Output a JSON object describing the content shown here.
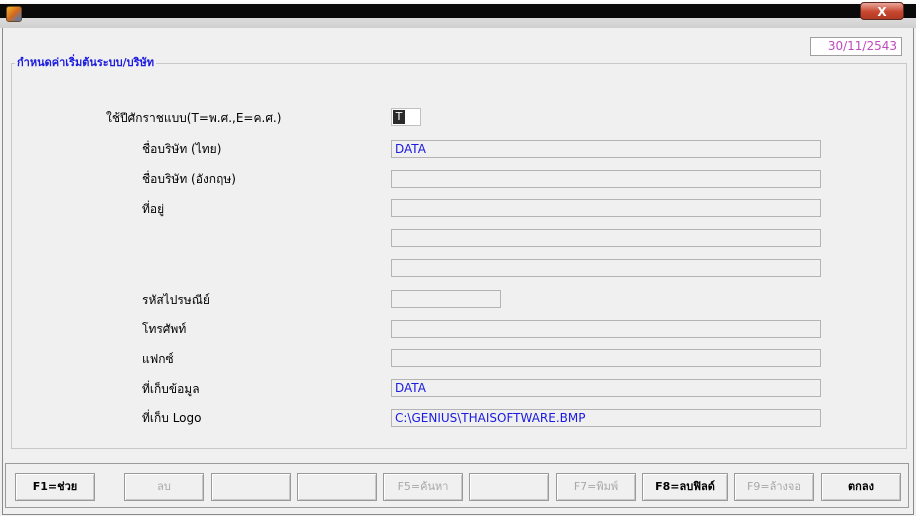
{
  "window": {
    "close_label": "X"
  },
  "date": "30/11/2543",
  "group_title": "กำหนดค่าเริ่มต้นระบบ/บริษัท",
  "form": {
    "era_label": "ใช้ปีศักราชแบบ(T=พ.ศ.,E=ค.ศ.)",
    "era_value": "T",
    "company_thai_label": "ชื่อบริษัท (ไทย)",
    "company_thai_value": "DATA",
    "company_eng_label": "ชื่อบริษัท (อังกฤษ)",
    "company_eng_value": "",
    "address_label": "ที่อยู่",
    "address_line1": "",
    "address_line2": "",
    "address_line3": "",
    "postcode_label": "รหัสไปรษณีย์",
    "postcode_value": "",
    "phone_label": "โทรศัพท์",
    "phone_value": "",
    "fax_label": "แฟกซ์",
    "fax_value": "",
    "data_dir_label": "ที่เก็บข้อมูล",
    "data_dir_value": "DATA",
    "logo_label": "ที่เก็บ Logo",
    "logo_value": "C:\\GENIUS\\THAISOFTWARE.BMP"
  },
  "buttons": {
    "f1": "F1=ช่วย",
    "delete": "ลบ",
    "blank1": "",
    "blank2": "",
    "f5": "F5=ค้นหา",
    "blank3": "",
    "f7": "F7=พิมพ์",
    "f8": "F8=ลบฟิลด์",
    "f9": "F9=ล้างจอ",
    "ok": "ตกลง"
  },
  "colors": {
    "accent_blue": "#1a1ae0",
    "date_magenta": "#c04ac0",
    "close_red": "#c7472f"
  }
}
